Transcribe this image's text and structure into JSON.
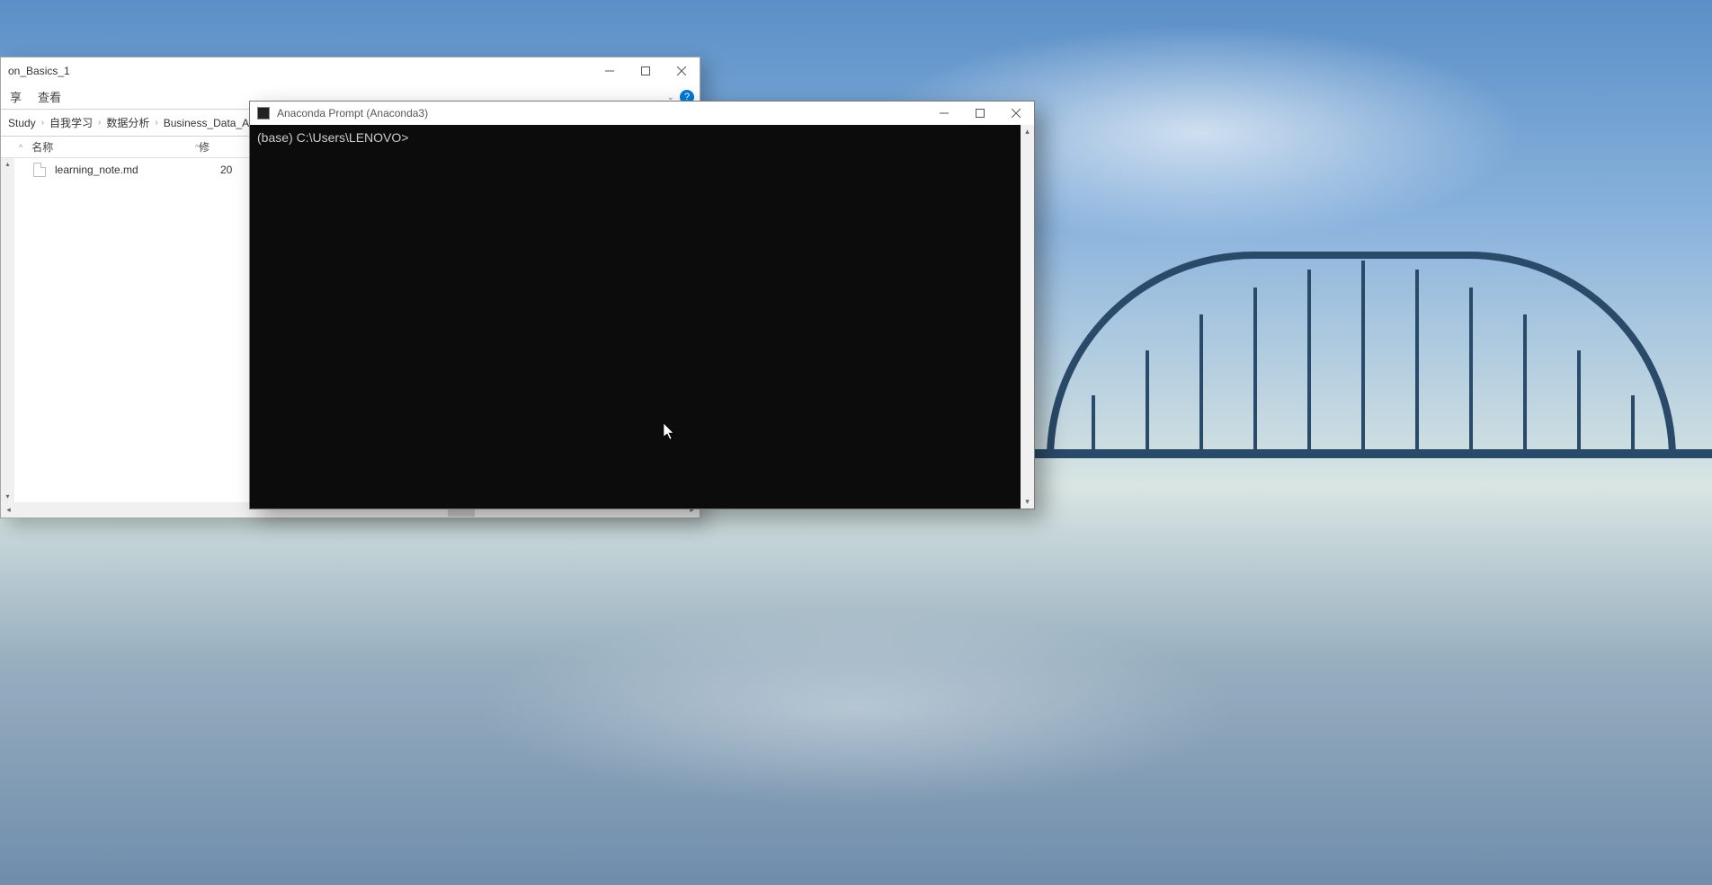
{
  "explorer": {
    "title": "on_Basics_1",
    "menu": {
      "share_partial": "享",
      "view": "查看"
    },
    "breadcrumb": [
      "Study",
      "自我学习",
      "数据分析",
      "Business_Data_Analy"
    ],
    "columns": {
      "name": "名称",
      "modified": "修"
    },
    "files": [
      {
        "name": "learning_note.md",
        "modified_partial": "20"
      }
    ]
  },
  "terminal": {
    "title": "Anaconda Prompt (Anaconda3)",
    "prompt": "(base) C:\\Users\\LENOVO>"
  }
}
